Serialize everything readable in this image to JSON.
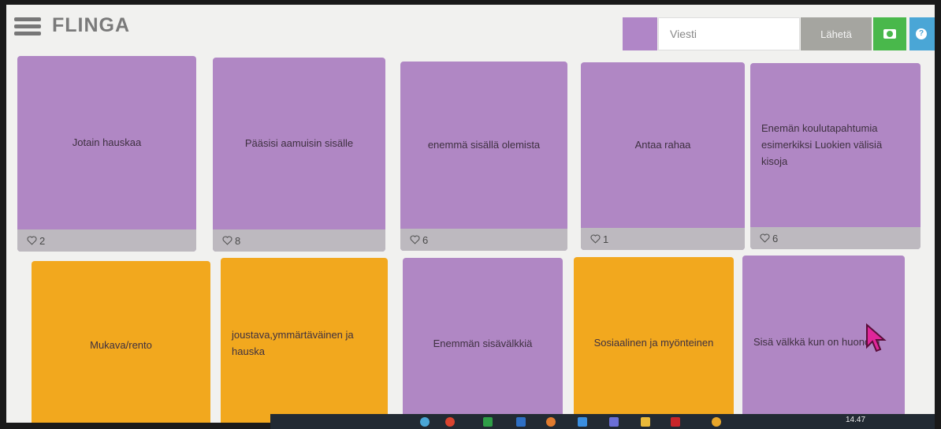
{
  "header": {
    "logo": "FLINGA",
    "message_placeholder": "Viesti",
    "send_label": "Lähetä",
    "swatch_color": "#b086c7"
  },
  "cards": [
    {
      "text": "Jotain hauskaa",
      "likes": "2",
      "color": "purple"
    },
    {
      "text": "Pääsisi aamuisin sisälle",
      "likes": "8",
      "color": "purple"
    },
    {
      "text": "enemmä sisällä olemista",
      "likes": "6",
      "color": "purple"
    },
    {
      "text": "Antaa rahaa",
      "likes": "1",
      "color": "purple"
    },
    {
      "text": "Enemän koulutapahtumia esimerkiksi Luokien välisiä kisoja",
      "likes": "6",
      "color": "purple"
    },
    {
      "text": "Mukava/rento",
      "color": "orange"
    },
    {
      "text": "joustava,ymmärtäväinen ja hauska",
      "color": "orange"
    },
    {
      "text": "Enemmän sisävälkkiä",
      "color": "purple"
    },
    {
      "text": "Sosiaalinen ja myönteinen",
      "color": "orange"
    },
    {
      "text": "Sisä välkkä kun on huono ili",
      "color": "purple"
    }
  ],
  "taskbar": {
    "clock": "14.47"
  },
  "colors": {
    "purple": "#b087c4",
    "orange": "#f2a81e",
    "send": "#a5a5a0",
    "camera": "#49b84b",
    "help": "#4aa6d6"
  }
}
